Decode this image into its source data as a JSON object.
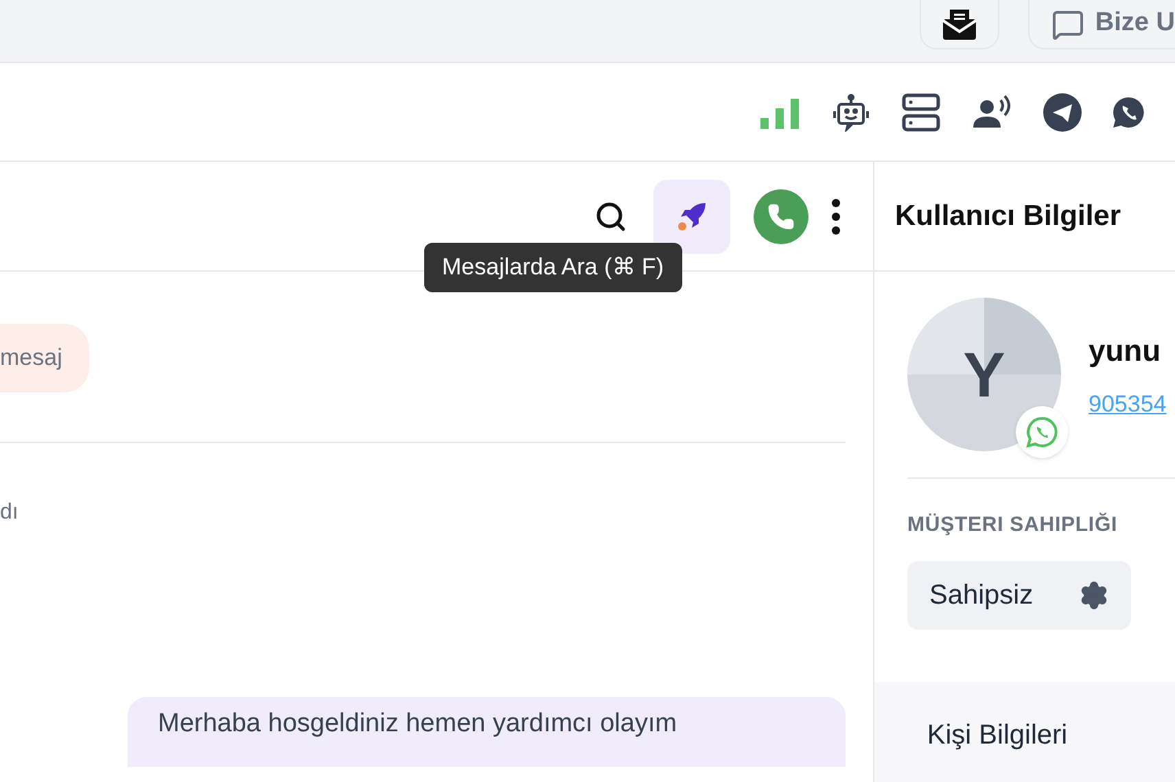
{
  "top_bar": {
    "help_button": "Bize U"
  },
  "chat": {
    "tooltip": "Mesajlarda Ara (⌘ F)",
    "messages": [
      {
        "kind": "bubble_in",
        "text": "mesaj"
      },
      {
        "kind": "divider"
      },
      {
        "kind": "note",
        "text": "dı"
      },
      {
        "kind": "bubble_out",
        "text": "Merhaba hosgeldiniz hemen yardımcı olayım"
      }
    ]
  },
  "user_panel": {
    "title": "Kullanıcı Bilgiler",
    "avatar_letter": "Y",
    "name": "yunu",
    "phone": "905354",
    "ownership_label": "MÜŞTERI SAHIPLIĞI",
    "ownership_value": "Sahipsiz",
    "section_tab": "Kişi Bilgileri"
  }
}
